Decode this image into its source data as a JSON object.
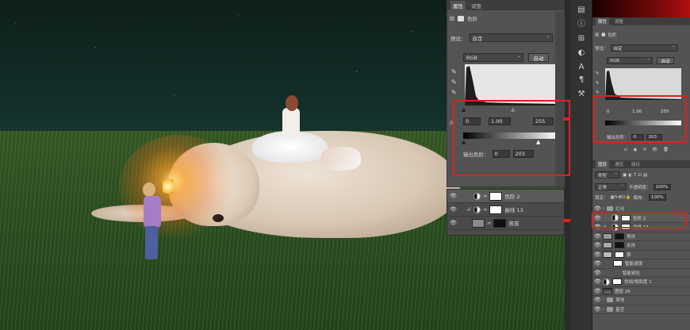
{
  "properties": {
    "tabs": [
      "属性",
      "调整"
    ],
    "adjustment_name": "色阶",
    "preset_label": "预设：",
    "preset_value": "自定",
    "channel": "RGB",
    "auto_button": "自动",
    "input_black": "0",
    "input_gamma": "1.00",
    "input_white": "255",
    "output_label": "输出色阶：",
    "output_black": "0",
    "output_white": "203"
  },
  "layers_snippet": [
    {
      "name": "色阶 2",
      "selected": true
    },
    {
      "name": "曲线 13",
      "selected": false
    },
    {
      "name": "男孩",
      "selected": false
    }
  ],
  "dock": {
    "tabs": [
      "属性",
      "调整"
    ],
    "adjustment_name": "色阶",
    "preset_label": "预设：",
    "preset_value": "自定",
    "channel": "RGB",
    "auto_button": "自动",
    "input_black": "0",
    "input_gamma": "1.00",
    "input_white": "255",
    "output_label": "输出色阶：",
    "output_black": "0",
    "output_white": "203",
    "layer_tabs": [
      "图层",
      "通道",
      "路径"
    ],
    "filter_kind": "类型",
    "blend_mode": "正常",
    "opacity_label": "不透明度：",
    "opacity_value": "100%",
    "lock_label": "锁定：",
    "fill_label": "填充：",
    "fill_value": "100%",
    "layers": [
      {
        "name": "灯光",
        "type": "group"
      },
      {
        "name": "色阶 2",
        "type": "adjust",
        "selected": true
      },
      {
        "name": "曲线 13",
        "type": "adjust"
      },
      {
        "name": "男孩",
        "type": "image"
      },
      {
        "name": "女孩",
        "type": "image"
      },
      {
        "name": "狼",
        "type": "image"
      },
      {
        "name": "智能滤镜",
        "type": "filter"
      },
      {
        "name": "智能锐化",
        "type": "filter"
      },
      {
        "name": "色相/饱和度 1",
        "type": "adjust"
      },
      {
        "name": "图层 29",
        "type": "image"
      },
      {
        "name": "草地",
        "type": "group"
      },
      {
        "name": "星空",
        "type": "group"
      }
    ]
  },
  "colors": {
    "highlight": "#e02020",
    "panel": "#535353"
  }
}
